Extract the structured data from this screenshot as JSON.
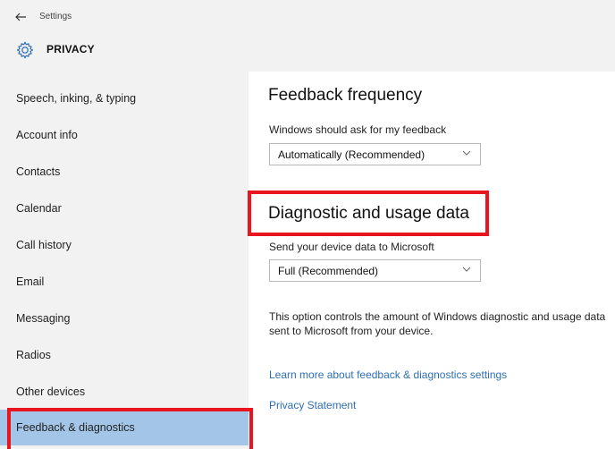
{
  "window": {
    "app_title": "Settings",
    "section_title": "PRIVACY"
  },
  "sidebar": {
    "items": [
      {
        "label": "Speech, inking, & typing"
      },
      {
        "label": "Account info"
      },
      {
        "label": "Contacts"
      },
      {
        "label": "Calendar"
      },
      {
        "label": "Call history"
      },
      {
        "label": "Email"
      },
      {
        "label": "Messaging"
      },
      {
        "label": "Radios"
      },
      {
        "label": "Other devices"
      },
      {
        "label": "Feedback & diagnostics",
        "selected": true
      }
    ]
  },
  "main": {
    "feedback_frequency": {
      "title": "Feedback frequency",
      "label": "Windows should ask for my feedback",
      "value": "Automatically (Recommended)"
    },
    "diagnostic": {
      "title": "Diagnostic and usage data",
      "label": "Send your device data to Microsoft",
      "value": "Full (Recommended)",
      "description": "This option controls the amount of Windows diagnostic and usage data sent to Microsoft from your device."
    },
    "links": {
      "learn_more": "Learn more about feedback & diagnostics settings",
      "privacy_statement": "Privacy Statement"
    }
  },
  "colors": {
    "accent_selected": "#a3c6e8",
    "highlight": "#e8141e",
    "link": "#2e6fb3"
  },
  "icons": [
    "back-arrow-icon",
    "gear-icon",
    "chevron-down-icon"
  ]
}
